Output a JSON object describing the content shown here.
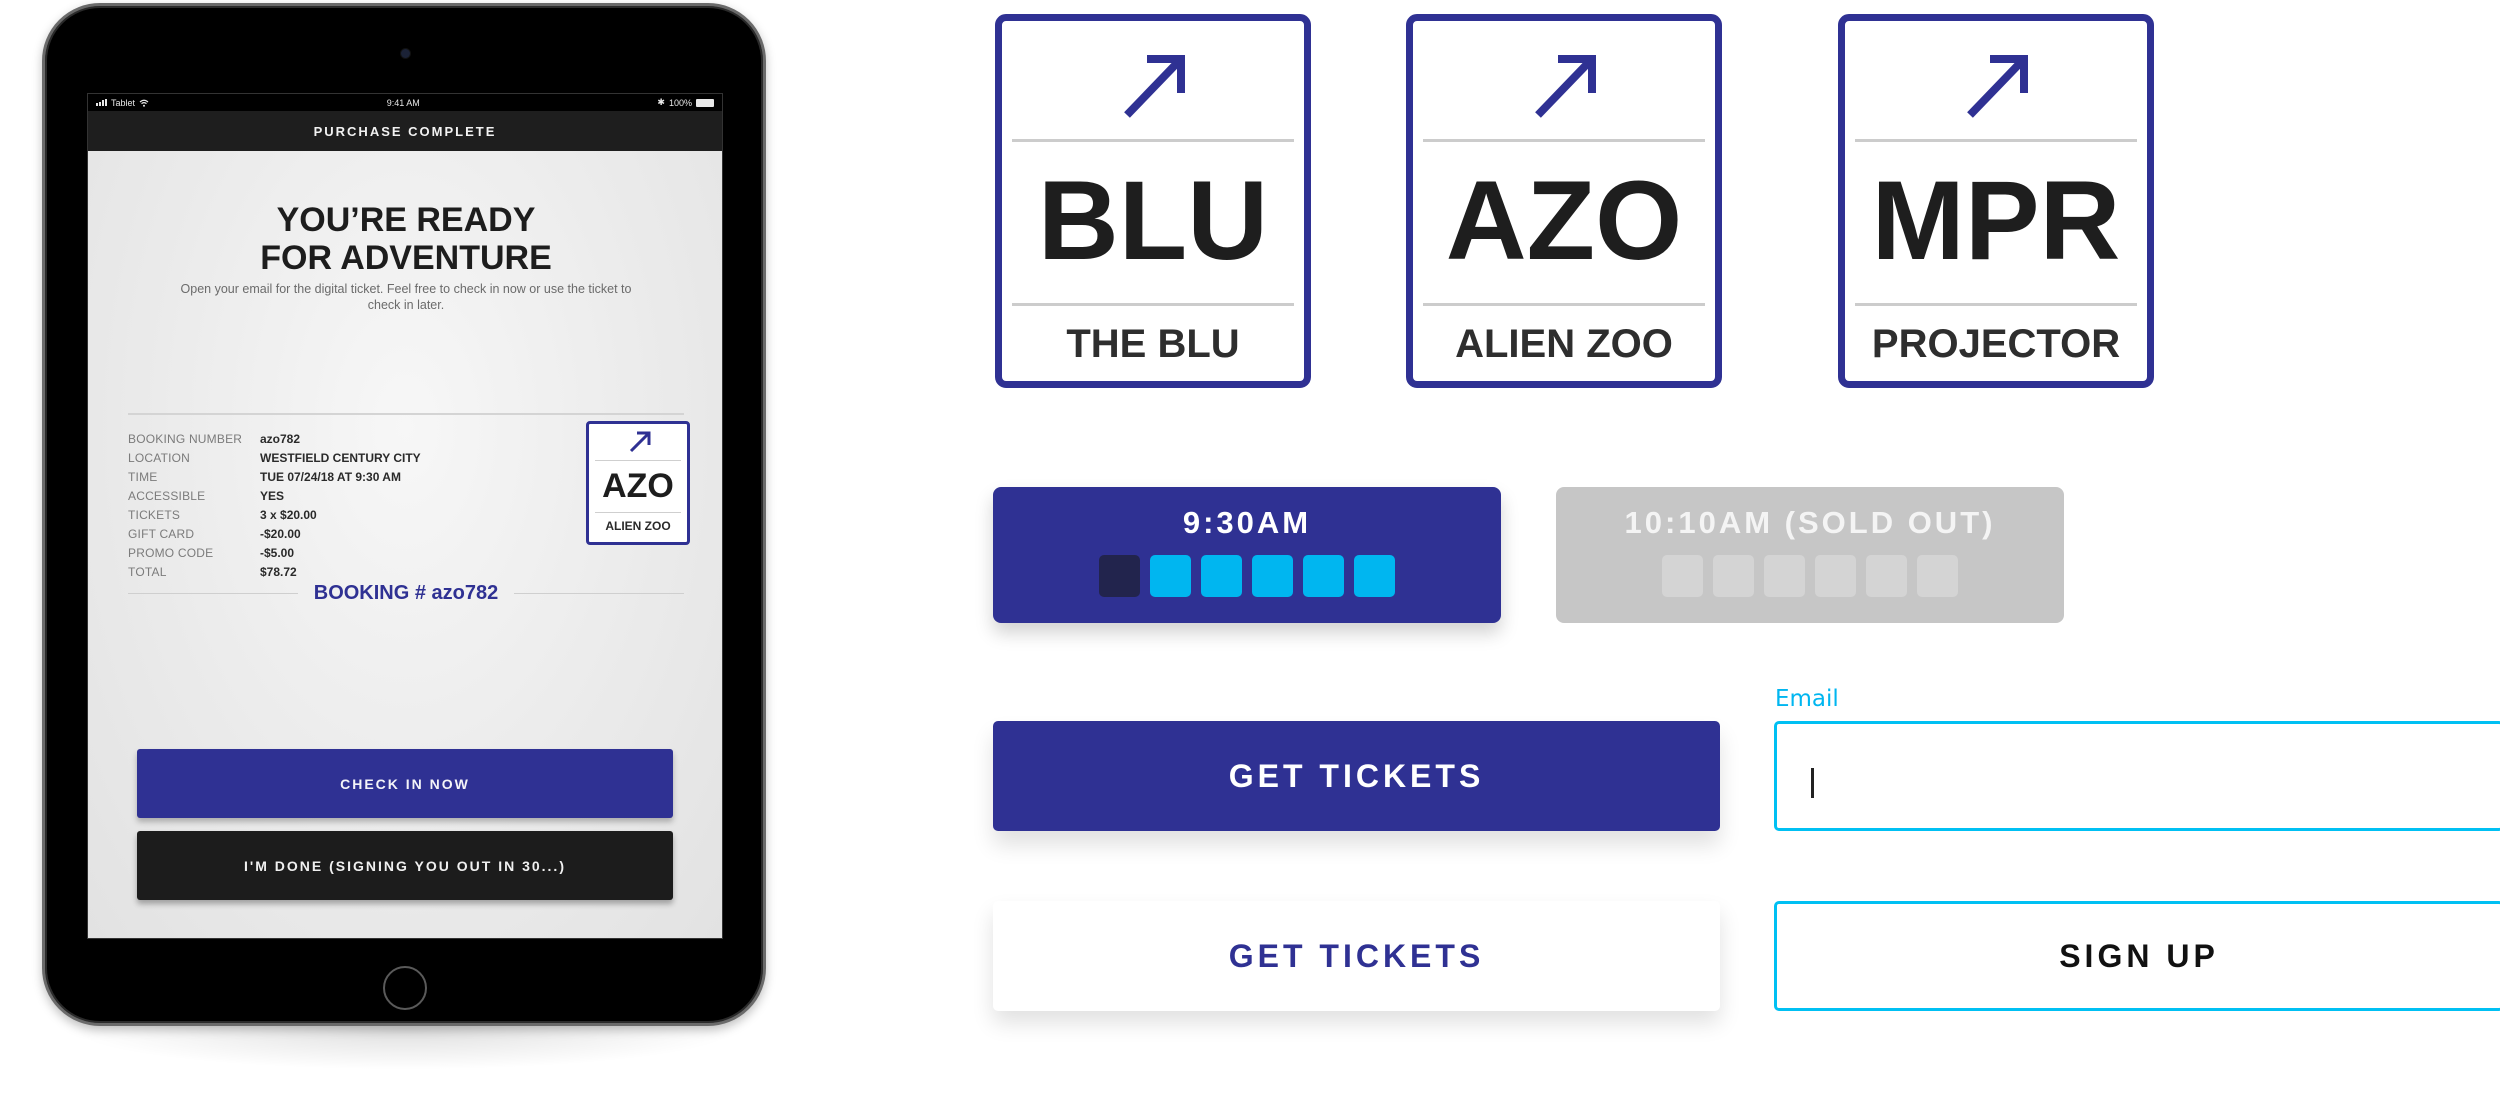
{
  "tablet": {
    "status_bar": {
      "carrier": "Tablet",
      "time": "9:41 AM",
      "battery": "100%"
    },
    "header_title": "PURCHASE COMPLETE",
    "hero": {
      "title_line1": "YOU’RE READY",
      "title_line2": "FOR ADVENTURE",
      "subtitle": "Open your email for the digital ticket.  Feel free to check in now or use the ticket to check in later."
    },
    "details": [
      {
        "label": "BOOKING NUMBER",
        "value": "azo782"
      },
      {
        "label": "LOCATION",
        "value": "WESTFIELD CENTURY CITY"
      },
      {
        "label": "TIME",
        "value": "TUE 07/24/18 AT 9:30 AM"
      },
      {
        "label": "ACCESSIBLE",
        "value": "YES"
      },
      {
        "label": "TICKETS",
        "value": "3 x $20.00"
      },
      {
        "label": "GIFT CARD",
        "value": "-$20.00"
      },
      {
        "label": "PROMO CODE",
        "value": "-$5.00"
      },
      {
        "label": "TOTAL",
        "value": "$78.72"
      }
    ],
    "mini_card": {
      "code": "AZO",
      "name": "ALIEN ZOO",
      "icon": "arrow-up-right-icon"
    },
    "booking_label": "BOOKING # azo782",
    "check_in_button": "CHECK IN NOW",
    "done_button": "I'M DONE (SIGNING YOU OUT IN 30...)"
  },
  "ride_cards": [
    {
      "code": "BLU",
      "name": "THE BLU",
      "icon": "arrow-up-right-icon"
    },
    {
      "code": "AZO",
      "name": "ALIEN ZOO",
      "icon": "arrow-up-right-icon"
    },
    {
      "code": "MPR",
      "name": "PROJECTOR",
      "icon": "arrow-up-right-icon"
    }
  ],
  "time_slots": [
    {
      "time": "9:30AM",
      "state": "active",
      "seats": [
        "taken",
        "open",
        "open",
        "open",
        "open",
        "open"
      ]
    },
    {
      "time": "10:10AM (SOLD OUT)",
      "state": "soldout",
      "seats": [
        "disabled",
        "disabled",
        "disabled",
        "disabled",
        "disabled",
        "disabled"
      ]
    }
  ],
  "buttons": {
    "get_tickets_primary": "GET TICKETS",
    "get_tickets_secondary": "GET TICKETS",
    "sign_up": "SIGN UP"
  },
  "email": {
    "label": "Email",
    "value": "",
    "placeholder": ""
  },
  "colors": {
    "brand_blue": "#2f3193",
    "accent_cyan": "#00b6f0",
    "seat_taken": "#22244d",
    "disabled_gray": "#c6c6c6",
    "dark_button": "#1c1c1c"
  }
}
